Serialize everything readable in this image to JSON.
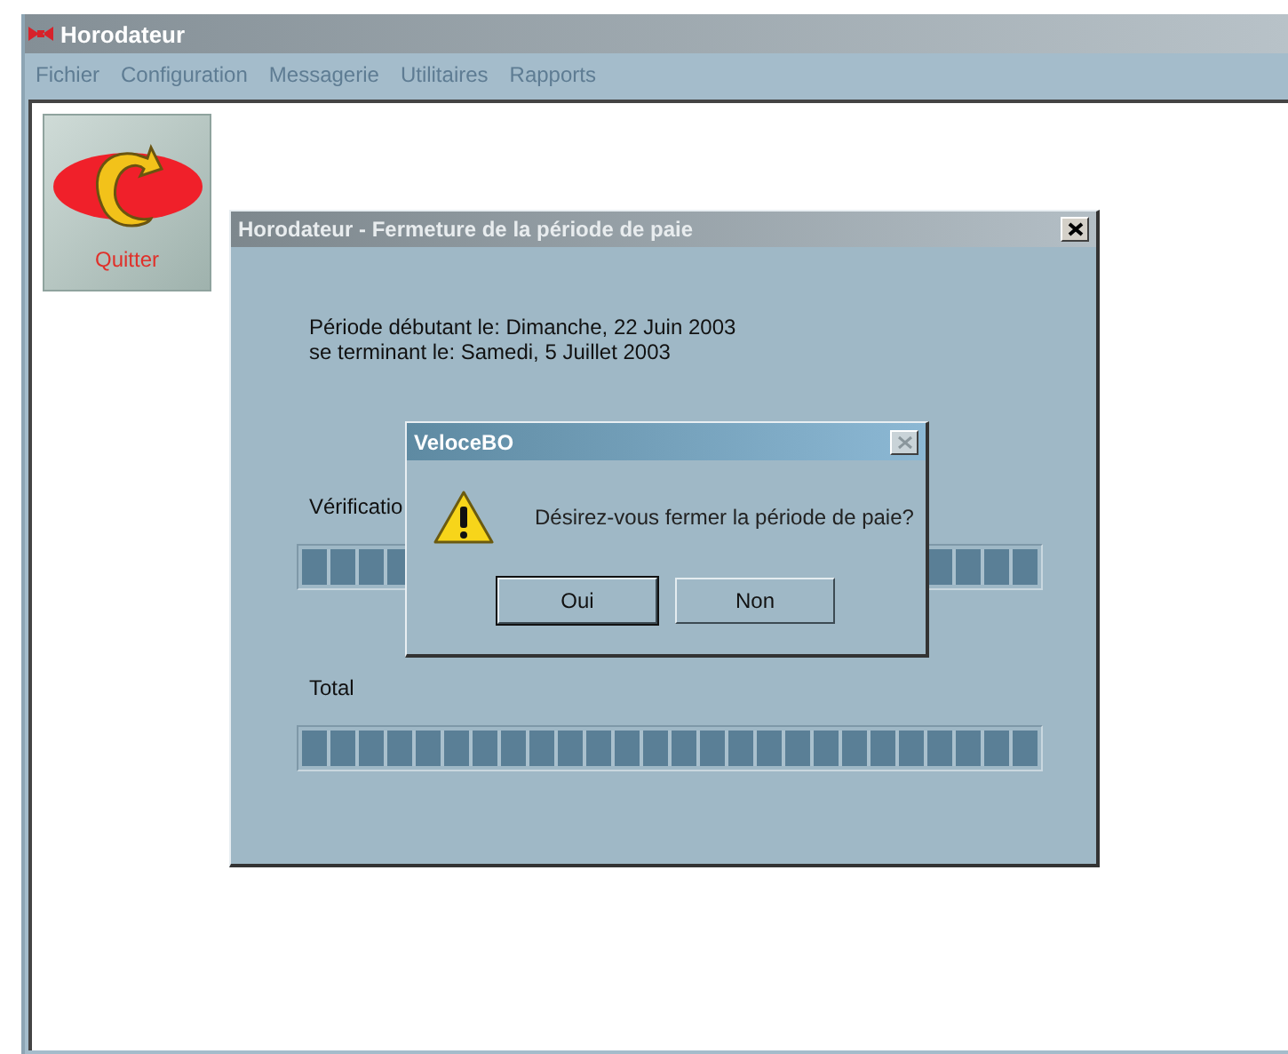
{
  "window": {
    "title": "Horodateur"
  },
  "menu": [
    "Fichier",
    "Configuration",
    "Messagerie",
    "Utilitaires",
    "Rapports"
  ],
  "quit_button": {
    "label": "Quitter"
  },
  "period_dialog": {
    "title": "Horodateur - Fermeture de la période de paie",
    "period_lines": [
      "Période débutant le: Dimanche, 22 Juin 2003",
      "se terminant le: Samedi, 5 Juillet 2003"
    ],
    "progress": [
      {
        "label": "Vérificatio",
        "level": 1
      },
      {
        "label": "Total",
        "level": 1
      }
    ]
  },
  "message_box": {
    "title": "VeloceBO",
    "message": "Désirez-vous fermer la période de paie?",
    "buttons": [
      {
        "label": "Oui",
        "default": true
      },
      {
        "label": "Non",
        "default": false
      }
    ]
  }
}
